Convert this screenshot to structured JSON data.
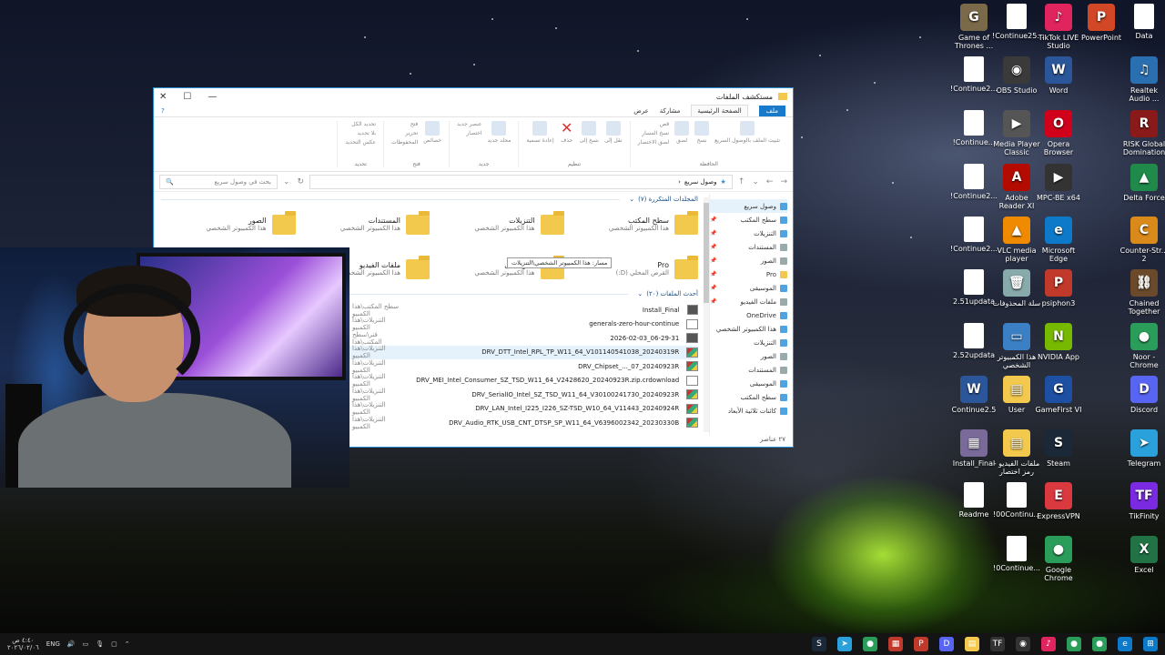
{
  "desktop": {
    "icons": [
      {
        "label": "Game of Thrones ...",
        "color": "#7a6a4a",
        "glyph": "G"
      },
      {
        "label": "!Continue25...",
        "color": "doc",
        "glyph": ""
      },
      {
        "label": "TikTok LIVE Studio",
        "color": "#e0245e",
        "glyph": "♪"
      },
      {
        "label": "PowerPoint",
        "color": "#d24726",
        "glyph": "P"
      },
      {
        "label": "Data",
        "color": "doc",
        "glyph": ""
      },
      {
        "label": "!Continue2...",
        "color": "doc",
        "glyph": ""
      },
      {
        "label": "OBS Studio",
        "color": "#3a3a3a",
        "glyph": "◉"
      },
      {
        "label": "Word",
        "color": "#2b579a",
        "glyph": "W"
      },
      {
        "label": "Realtek Audio ...",
        "color": "#2a6fb0",
        "glyph": "♫"
      },
      {
        "label": "!Continue...",
        "color": "doc",
        "glyph": ""
      },
      {
        "label": "Media Player Classic",
        "color": "#555",
        "glyph": "▶"
      },
      {
        "label": "Opera Browser",
        "color": "#d0021b",
        "glyph": "O"
      },
      {
        "label": "RISK Global Domination",
        "color": "#8a1a1a",
        "glyph": "R"
      },
      {
        "label": "!Continue2...",
        "color": "doc",
        "glyph": ""
      },
      {
        "label": "Adobe Reader XI",
        "color": "#b30b00",
        "glyph": "A"
      },
      {
        "label": "MPC-BE x64",
        "color": "#333",
        "glyph": "▶"
      },
      {
        "label": "Delta Force",
        "color": "#1f8a4a",
        "glyph": "▲"
      },
      {
        "label": "!Continue2...",
        "color": "doc",
        "glyph": ""
      },
      {
        "label": "VLC media player",
        "color": "#f08a00",
        "glyph": "▲"
      },
      {
        "label": "Microsoft Edge",
        "color": "#0c7ac9",
        "glyph": "e"
      },
      {
        "label": "Counter-Str... 2",
        "color": "#d98a1a",
        "glyph": "C"
      },
      {
        "label": "2.51updata",
        "color": "doc",
        "glyph": ""
      },
      {
        "label": "سلة المحذوفات",
        "color": "#8aa",
        "glyph": "🗑"
      },
      {
        "label": "psiphon3",
        "color": "#c0392b",
        "glyph": "P"
      },
      {
        "label": "Chained Together",
        "color": "#6a4a2a",
        "glyph": "⛓"
      },
      {
        "label": "2.52updata",
        "color": "doc",
        "glyph": ""
      },
      {
        "label": "هذا الكمبيوتر الشخصي",
        "color": "#3b7fc4",
        "glyph": "▭"
      },
      {
        "label": "NVIDIA App",
        "color": "#76b900",
        "glyph": "N"
      },
      {
        "label": "Noor - Chrome",
        "color": "#2a9d5a",
        "glyph": "●"
      },
      {
        "label": "Continue2.5",
        "color": "#2b579a",
        "glyph": "W"
      },
      {
        "label": "User",
        "color": "#f2c94c",
        "glyph": "▤"
      },
      {
        "label": "GameFirst VI",
        "color": "#1d4fa3",
        "glyph": "G"
      },
      {
        "label": "Discord",
        "color": "#5865f2",
        "glyph": "D"
      },
      {
        "label": "Install_Final",
        "color": "#7a6a9a",
        "glyph": "▦"
      },
      {
        "label": "ملفات الفيديو - رمز اختصار",
        "color": "#f2c94c",
        "glyph": "▤"
      },
      {
        "label": "Steam",
        "color": "#1b2838",
        "glyph": "S"
      },
      {
        "label": "Telegram",
        "color": "#2aa1da",
        "glyph": "➤"
      },
      {
        "label": "Readme",
        "color": "doc",
        "glyph": ""
      },
      {
        "label": "!00Continu...",
        "color": "doc",
        "glyph": ""
      },
      {
        "label": "ExpressVPN",
        "color": "#da3940",
        "glyph": "E"
      },
      {
        "label": "TikFinity",
        "color": "#7a2ae0",
        "glyph": "TF"
      },
      {
        "label": "!0Continue...",
        "color": "doc",
        "glyph": ""
      },
      {
        "label": "Google Chrome",
        "color": "#2a9d5a",
        "glyph": "●"
      },
      {
        "label": "Excel",
        "color": "#217346",
        "glyph": "X"
      }
    ]
  },
  "explorer": {
    "title": "مستكشف الملفات",
    "tabs": {
      "file": "ملف",
      "home": "الصفحة الرئيسية",
      "share": "مشاركة",
      "view": "عرض"
    },
    "ribbon_groups": [
      {
        "name": "الحافظة",
        "buttons": [
          "تثبيت الملف بالوصول السريع",
          "نسخ",
          "لصق"
        ],
        "small": [
          "قص",
          "نسخ المسار",
          "لصق الاختصار"
        ]
      },
      {
        "name": "تنظيم",
        "buttons": [
          "نقل إلى",
          "نسخ إلى",
          "حذف",
          "إعادة تسمية"
        ],
        "small": []
      },
      {
        "name": "جديد",
        "buttons": [
          "مجلد جديد"
        ],
        "small": [
          "عنصر جديد",
          "اختصار"
        ]
      },
      {
        "name": "فتح",
        "buttons": [
          "خصائص"
        ],
        "small": [
          "فتح",
          "تحرير",
          "المحفوظات"
        ]
      },
      {
        "name": "تحديد",
        "buttons": [],
        "small": [
          "تحديد الكل",
          "بلا تحديد",
          "عكس التحديد"
        ]
      }
    ],
    "search_placeholder": "بحث في وصول سريع",
    "address": "وصول سريع",
    "nav_items": [
      {
        "label": "وصول سريع",
        "cls": ""
      },
      {
        "label": "سطح المكتب",
        "cls": ""
      },
      {
        "label": "التنزيلات",
        "cls": ""
      },
      {
        "label": "المستندات",
        "cls": "g"
      },
      {
        "label": "الصور",
        "cls": "g"
      },
      {
        "label": "Pro",
        "cls": "y"
      },
      {
        "label": "الموسيقى",
        "cls": ""
      },
      {
        "label": "ملفات الفيديو",
        "cls": "g"
      },
      {
        "label": "OneDrive",
        "cls": ""
      },
      {
        "label": "هذا الكمبيوتر الشخصي",
        "cls": ""
      },
      {
        "label": "التنزيلات",
        "cls": ""
      },
      {
        "label": "الصور",
        "cls": "g"
      },
      {
        "label": "المستندات",
        "cls": "g"
      },
      {
        "label": "الموسيقى",
        "cls": ""
      },
      {
        "label": "سطح المكتب",
        "cls": ""
      },
      {
        "label": "كائنات ثلاثية الأبعاد",
        "cls": ""
      }
    ],
    "frequent_header": "المجلدات المتكررة (٧)",
    "recent_header": "أحدث الملفات (٢٠)",
    "folders": [
      {
        "name": "سطح المكتب",
        "sub": "هذا الكمبيوتر الشخصي"
      },
      {
        "name": "التنزيلات",
        "sub": "هذا الكمبيوتر الشخصي"
      },
      {
        "name": "المستندات",
        "sub": "هذا الكمبيوتر الشخصي"
      },
      {
        "name": "الصور",
        "sub": "هذا الكمبيوتر الشخصي"
      },
      {
        "name": "Pro",
        "sub": "القرص المحلي (D:)"
      },
      {
        "name": "الموسيقى",
        "sub": "هذا الكمبيوتر الشخصي"
      },
      {
        "name": "ملفات الفيديو",
        "sub": "هذا الكمبيوتر الشخصي"
      }
    ],
    "files": [
      {
        "name": "Install_Final",
        "path": "سطح المكتب\\هذا الكمبيو",
        "icon": "plain"
      },
      {
        "name": "generals-zero-hour-continue",
        "path": "التنزيلات\\هذا الكمبيو",
        "icon": "doc"
      },
      {
        "name": "2026-02-03_06-29-31",
        "path": "قتر\\سطح المكتب\\هذا",
        "icon": "plain"
      },
      {
        "name": "DRV_DTT_Intel_RPL_TP_W11_64_V101140541038_20240319R",
        "path": "التنزيلات\\هذا الكمبيو",
        "icon": "rar"
      },
      {
        "name": "DRV_Chipset_..._07_20240923R",
        "path": "التنزيلات\\هذا الكمبيو",
        "icon": "rar"
      },
      {
        "name": "DRV_MEI_Intel_Consumer_SZ_TSD_W11_64_V2428620_20240923R.zip.crdownload",
        "path": "التنزيلات\\هذا الكمبيو",
        "icon": "doc"
      },
      {
        "name": "DRV_SerialIO_Intel_SZ_TSD_W11_64_V30100241730_20240923R",
        "path": "التنزيلات\\هذا الكمبيو",
        "icon": "rar"
      },
      {
        "name": "DRV_LAN_Intel_I225_I226_SZ-TSD_W10_64_V11443_20240924R",
        "path": "التنزيلات\\هذا الكمبيو",
        "icon": "rar"
      },
      {
        "name": "DRV_Audio_RTK_USB_CNT_DTSP_SP_W11_64_V6396002342_20230330B",
        "path": "التنزيلات\\هذا الكمبيو",
        "icon": "rar"
      }
    ],
    "tooltip": "مسار: هذا الكمبيوتر الشخصي\\التنزيلات",
    "status": "٢٧ عناصر"
  },
  "taskbar": {
    "time": "٤:٤٠ ص",
    "date": "٢٠٢٦/٠٢/٠٦",
    "lang": "ENG",
    "apps": [
      {
        "name": "steam-app-icon",
        "color": "#1b2838",
        "glyph": "S"
      },
      {
        "name": "telegram-app-icon",
        "color": "#2aa1da",
        "glyph": "➤"
      },
      {
        "name": "chrome-app-icon",
        "color": "#2a9d5a",
        "glyph": "●"
      },
      {
        "name": "windows-app-icon",
        "color": "#c0392b",
        "glyph": "▦"
      },
      {
        "name": "psiphon-app-icon",
        "color": "#c0392b",
        "glyph": "P"
      },
      {
        "name": "discord-app-icon",
        "color": "#5865f2",
        "glyph": "D"
      },
      {
        "name": "explorer-app-icon",
        "color": "#f2c94c",
        "glyph": "▤"
      },
      {
        "name": "tikfinity-app-icon",
        "color": "#333",
        "glyph": "TF"
      },
      {
        "name": "obs-app-icon",
        "color": "#333",
        "glyph": "◉"
      },
      {
        "name": "tiktok-app-icon",
        "color": "#e0245e",
        "glyph": "♪"
      },
      {
        "name": "chrome2-app-icon",
        "color": "#2a9d5a",
        "glyph": "●"
      },
      {
        "name": "chrome3-app-icon",
        "color": "#2a9d5a",
        "glyph": "●"
      },
      {
        "name": "edge-app-icon",
        "color": "#0c7ac9",
        "glyph": "e"
      },
      {
        "name": "windows-start-icon",
        "color": "#0c7ac9",
        "glyph": "⊞"
      }
    ]
  }
}
